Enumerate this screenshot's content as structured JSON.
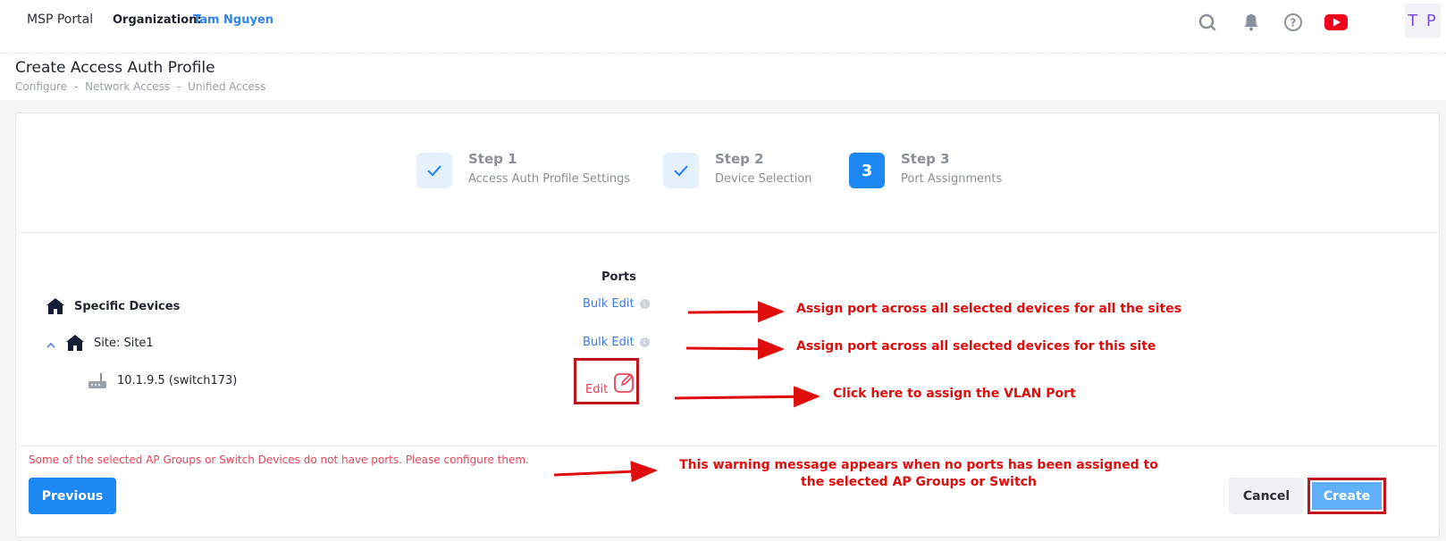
{
  "topbar": {
    "brand": "MSP Portal",
    "org_label": "Organization:",
    "org_name": "Tam Nguyen",
    "icons": [
      "search-icon",
      "bell-icon",
      "help-icon",
      "youtube-icon"
    ],
    "avatar_initials": "T P"
  },
  "page": {
    "title": "Create Access Auth Profile",
    "breadcrumb": [
      "Configure",
      "-",
      "Network Access",
      "-",
      "Unified Access"
    ]
  },
  "steps": [
    {
      "title": "Step 1",
      "subtitle": "Access Auth Profile Settings",
      "state": "done"
    },
    {
      "title": "Step 2",
      "subtitle": "Device Selection",
      "state": "done"
    },
    {
      "title": "Step 3",
      "subtitle": "Port Assignments",
      "state": "active",
      "number": "3"
    }
  ],
  "tree": {
    "ports_header": "Ports",
    "specific_devices": "Specific Devices",
    "site": "Site: Site1",
    "device": "10.1.9.5 (switch173)",
    "bulk_edit": "Bulk Edit",
    "info_glyph": "i",
    "edit": "Edit"
  },
  "footer": {
    "warning": "Some of the selected AP Groups or Switch Devices do not have ports. Please configure them.",
    "previous": "Previous",
    "cancel": "Cancel",
    "create": "Create"
  },
  "annotations": {
    "bulk_all": "Assign port across all selected devices for all the sites",
    "bulk_site": "Assign port across all selected devices for this site",
    "edit_port": "Click here to assign the VLAN Port",
    "warning_line1": "This warning message appears when no ports has been assigned to",
    "warning_line2": "the selected AP Groups or Switch"
  },
  "colors": {
    "primary": "#1e88f2",
    "annotation_red": "#e00d0d",
    "link_blue": "#3d7be0",
    "warning_red": "#e8455a"
  }
}
